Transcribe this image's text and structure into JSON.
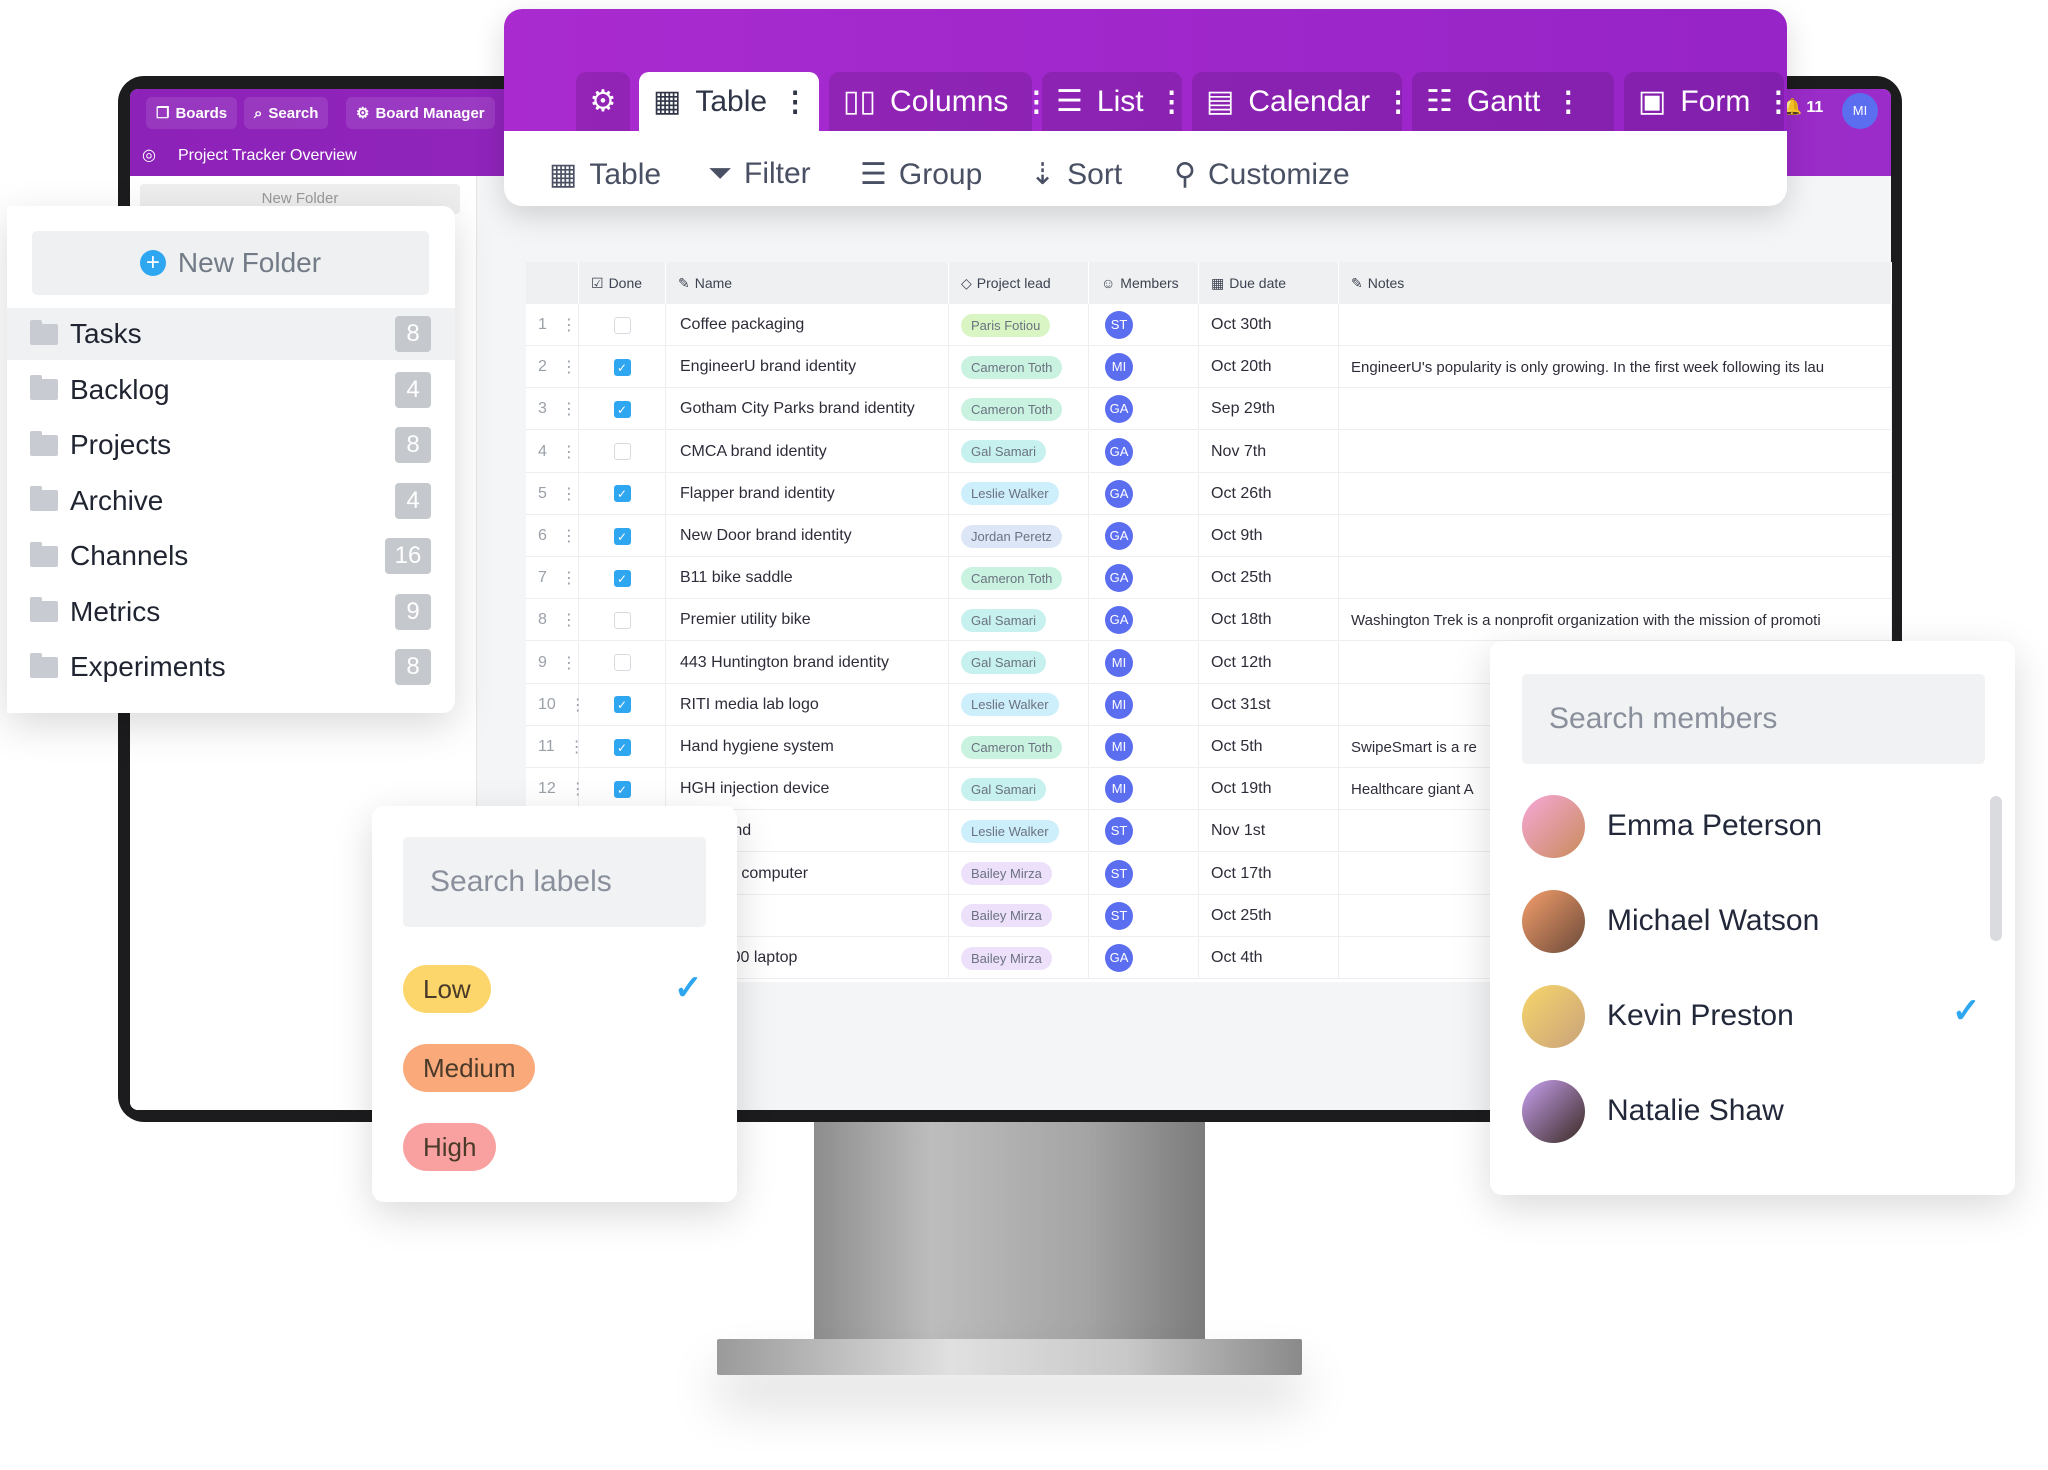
{
  "header": {
    "boards": "Boards",
    "search": "Search",
    "board_manager": "Board Manager",
    "project_title": "Project Tracker Overview",
    "notifications": "11",
    "user_initials": "MI",
    "new_folder_small": "New Folder"
  },
  "view_tabs": [
    {
      "label": "Table",
      "icon": "table-icon",
      "active": true
    },
    {
      "label": "Columns",
      "icon": "columns-icon"
    },
    {
      "label": "List",
      "icon": "list-icon"
    },
    {
      "label": "Calendar",
      "icon": "calendar-icon"
    },
    {
      "label": "Gantt",
      "icon": "gantt-icon"
    },
    {
      "label": "Form",
      "icon": "form-icon"
    }
  ],
  "tools": {
    "table": "Table",
    "filter": "Filter",
    "group": "Group",
    "sort": "Sort",
    "customize": "Customize"
  },
  "folders": {
    "new_folder": "New Folder",
    "items": [
      {
        "label": "Tasks",
        "count": "8"
      },
      {
        "label": "Backlog",
        "count": "4"
      },
      {
        "label": "Projects",
        "count": "8"
      },
      {
        "label": "Archive",
        "count": "4"
      },
      {
        "label": "Channels",
        "count": "16"
      },
      {
        "label": "Metrics",
        "count": "9"
      },
      {
        "label": "Experiments",
        "count": "8"
      }
    ]
  },
  "table": {
    "columns": [
      "Done",
      "Name",
      "Project lead",
      "Members",
      "Due date",
      "Notes"
    ],
    "rows": [
      {
        "n": "1",
        "done": false,
        "name": "Coffee packaging",
        "lead": "Paris Fotiou",
        "member": "ST",
        "due": "Oct 30th",
        "notes": ""
      },
      {
        "n": "2",
        "done": true,
        "name": "EngineerU brand identity",
        "lead": "Cameron Toth",
        "member": "MI",
        "due": "Oct 20th",
        "notes": "EngineerU's popularity is only growing. In the first week following its lau"
      },
      {
        "n": "3",
        "done": true,
        "name": "Gotham City Parks brand identity",
        "lead": "Cameron Toth",
        "member": "GA",
        "due": "Sep 29th",
        "notes": ""
      },
      {
        "n": "4",
        "done": false,
        "name": "CMCA brand identity",
        "lead": "Gal Samari",
        "member": "GA",
        "due": "Nov 7th",
        "notes": ""
      },
      {
        "n": "5",
        "done": true,
        "name": "Flapper brand identity",
        "lead": "Leslie Walker",
        "member": "GA",
        "due": "Oct 26th",
        "notes": ""
      },
      {
        "n": "6",
        "done": true,
        "name": "New Door brand identity",
        "lead": "Jordan Peretz",
        "member": "GA",
        "due": "Oct 9th",
        "notes": ""
      },
      {
        "n": "7",
        "done": true,
        "name": "B11 bike saddle",
        "lead": "Cameron Toth",
        "member": "GA",
        "due": "Oct 25th",
        "notes": ""
      },
      {
        "n": "8",
        "done": false,
        "name": "Premier utility bike",
        "lead": "Gal Samari",
        "member": "GA",
        "due": "Oct 18th",
        "notes": "Washington Trek is a nonprofit organization with the mission of promoti"
      },
      {
        "n": "9",
        "done": false,
        "name": "443 Huntington brand identity",
        "lead": "Gal Samari",
        "member": "MI",
        "due": "Oct 12th",
        "notes": ""
      },
      {
        "n": "10",
        "done": true,
        "name": "RITI media lab logo",
        "lead": "Leslie Walker",
        "member": "MI",
        "due": "Oct 31st",
        "notes": ""
      },
      {
        "n": "11",
        "done": true,
        "name": "Hand hygiene system",
        "lead": "Cameron Toth",
        "member": "MI",
        "due": "Oct 5th",
        "notes": "SwipeSmart is a re"
      },
      {
        "n": "12",
        "done": true,
        "name": "HGH injection device",
        "lead": "Gal Samari",
        "member": "MI",
        "due": "Oct 19th",
        "notes": "Healthcare giant A"
      },
      {
        "n": "",
        "done": false,
        "name": "headband",
        "lead": "Leslie Walker",
        "member": "ST",
        "due": "Nov 1st",
        "notes": ""
      },
      {
        "n": "",
        "done": false,
        "name": "otebook computer",
        "lead": "Bailey Mirza",
        "member": "ST",
        "due": "Oct 17th",
        "notes": ""
      },
      {
        "n": "",
        "done": false,
        "name": "d",
        "lead": "Bailey Mirza",
        "member": "ST",
        "due": "Oct 25th",
        "notes": ""
      },
      {
        "n": "",
        "done": false,
        "name": "tible 3000 laptop",
        "lead": "Bailey Mirza",
        "member": "GA",
        "due": "Oct 4th",
        "notes": ""
      }
    ]
  },
  "lead_colors": {
    "Paris Fotiou": "#d9f5c4",
    "Cameron Toth": "#c9f3e0",
    "Gal Samari": "#c6f1ee",
    "Leslie Walker": "#cdeefb",
    "Jordan Peretz": "#dde6f7",
    "Bailey Mirza": "#ece0fa"
  },
  "labels_popup": {
    "placeholder": "Search labels",
    "items": [
      {
        "label": "Low",
        "color": "#fcd66a",
        "selected": true
      },
      {
        "label": "Medium",
        "color": "#f9a97a"
      },
      {
        "label": "High",
        "color": "#f9a1a1"
      }
    ]
  },
  "members_popup": {
    "placeholder": "Search members",
    "items": [
      {
        "name": "Emma Peterson"
      },
      {
        "name": "Michael Watson"
      },
      {
        "name": "Kevin Preston",
        "selected": true
      },
      {
        "name": "Natalie Shaw"
      }
    ]
  },
  "colors": {
    "brand_purple": "#9b2cc9",
    "accent_blue": "#2fa6f0",
    "avatar_blue": "#5b6ef0"
  }
}
